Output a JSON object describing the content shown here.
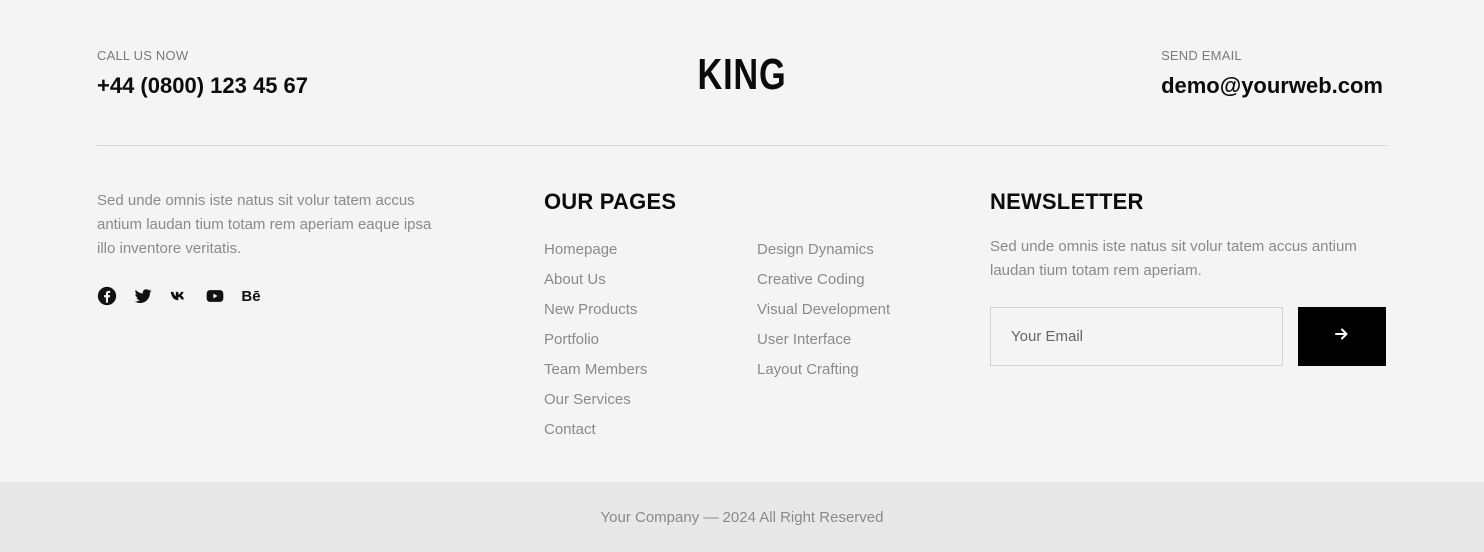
{
  "header": {
    "call": {
      "label": "CALL US NOW",
      "value": "+44 (0800) 123 45 67"
    },
    "logo": "KING",
    "email": {
      "label": "SEND EMAIL",
      "value": "demo@yourweb.com"
    }
  },
  "about": {
    "text": "Sed unde omnis iste natus sit volur tatem accus antium laudan tium totam rem aperiam eaque ipsa illo inventore veritatis.",
    "social": [
      {
        "icon": "facebook-icon"
      },
      {
        "icon": "twitter-icon"
      },
      {
        "icon": "vk-icon"
      },
      {
        "icon": "youtube-icon"
      },
      {
        "icon": "behance-icon",
        "text": "Bē"
      }
    ]
  },
  "pages": {
    "title": "OUR PAGES",
    "col1": [
      "Homepage",
      "About Us",
      "New Products",
      "Portfolio",
      "Team Members",
      "Our Services",
      "Contact"
    ],
    "col2": [
      "Design Dynamics",
      "Creative Coding",
      "Visual Development",
      "User Interface",
      "Layout Crafting"
    ]
  },
  "newsletter": {
    "title": "NEWSLETTER",
    "text": "Sed unde omnis iste natus sit volur tatem accus antium laudan tium totam rem aperiam.",
    "placeholder": "Your Email",
    "submit_icon": "arrow-right-icon"
  },
  "footer": {
    "copyright": "Your Company — 2024 All Right Reserved"
  }
}
